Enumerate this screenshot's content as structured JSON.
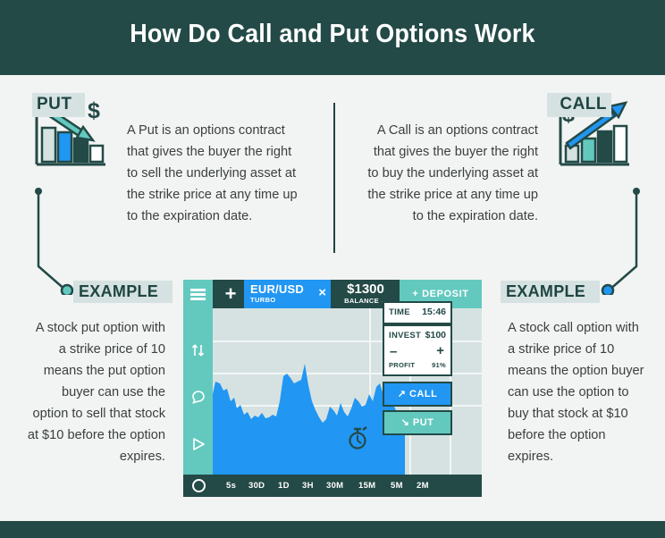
{
  "header": {
    "title": "How Do Call and Put Options Work"
  },
  "colors": {
    "dark_teal": "#234a47",
    "teal": "#63c9bf",
    "blue": "#2196f3",
    "page_bg": "#f2f4f3",
    "tag_bg": "#d5e2e1"
  },
  "put_section": {
    "tag": "PUT",
    "body": "A Put is an options contract that gives the buyer the right to sell the underlying asset at the strike price at any time up to the expiration date.",
    "icon": "declining-bar-chart-icon",
    "currency_symbol": "$"
  },
  "call_section": {
    "tag": "CALL",
    "body": "A Call is an options contract that gives the buyer the right to buy the underlying asset at the strike price at any time up to the expiration date.",
    "icon": "rising-bar-chart-icon",
    "currency_symbol": "$"
  },
  "example_left": {
    "tag": "EXAMPLE",
    "body": "A stock put option with a strike price of 10 means the put option buyer can use the option to sell that stock at $10 before the option expires."
  },
  "example_right": {
    "tag": "EXAMPLE",
    "body": "A stock call option with a strike price of 10 means the option buyer can use the option to buy that stock at $10 before the option expires."
  },
  "app": {
    "menu_icon": "hamburger-menu-icon",
    "add_label": "+",
    "pair": {
      "name": "EUR/USD",
      "type": "TURBO",
      "close_label": "×"
    },
    "balance": {
      "amount": "$1300",
      "label": "BALANCE ⌄"
    },
    "deposit_label": "+  DEPOSIT",
    "sidebar_icons": [
      "sort-arrows-icon",
      "chat-bubble-icon",
      "play-icon"
    ],
    "chart": {
      "timer_icon": "stopwatch-icon"
    },
    "time_panel": {
      "label": "TIME",
      "value": "15:46"
    },
    "invest_panel": {
      "label": "INVEST",
      "value": "$100",
      "decrease": "–",
      "increase": "+",
      "profit_label": "PROFIT",
      "profit_value": "91%"
    },
    "call_button": {
      "label": "CALL",
      "arrow": "↗"
    },
    "put_button": {
      "label": "PUT",
      "arrow": "↘"
    },
    "timeframes": [
      "5s",
      "30D",
      "1D",
      "3H",
      "30M",
      "15M",
      "5M",
      "2M"
    ],
    "record_icon": "circle-icon"
  }
}
